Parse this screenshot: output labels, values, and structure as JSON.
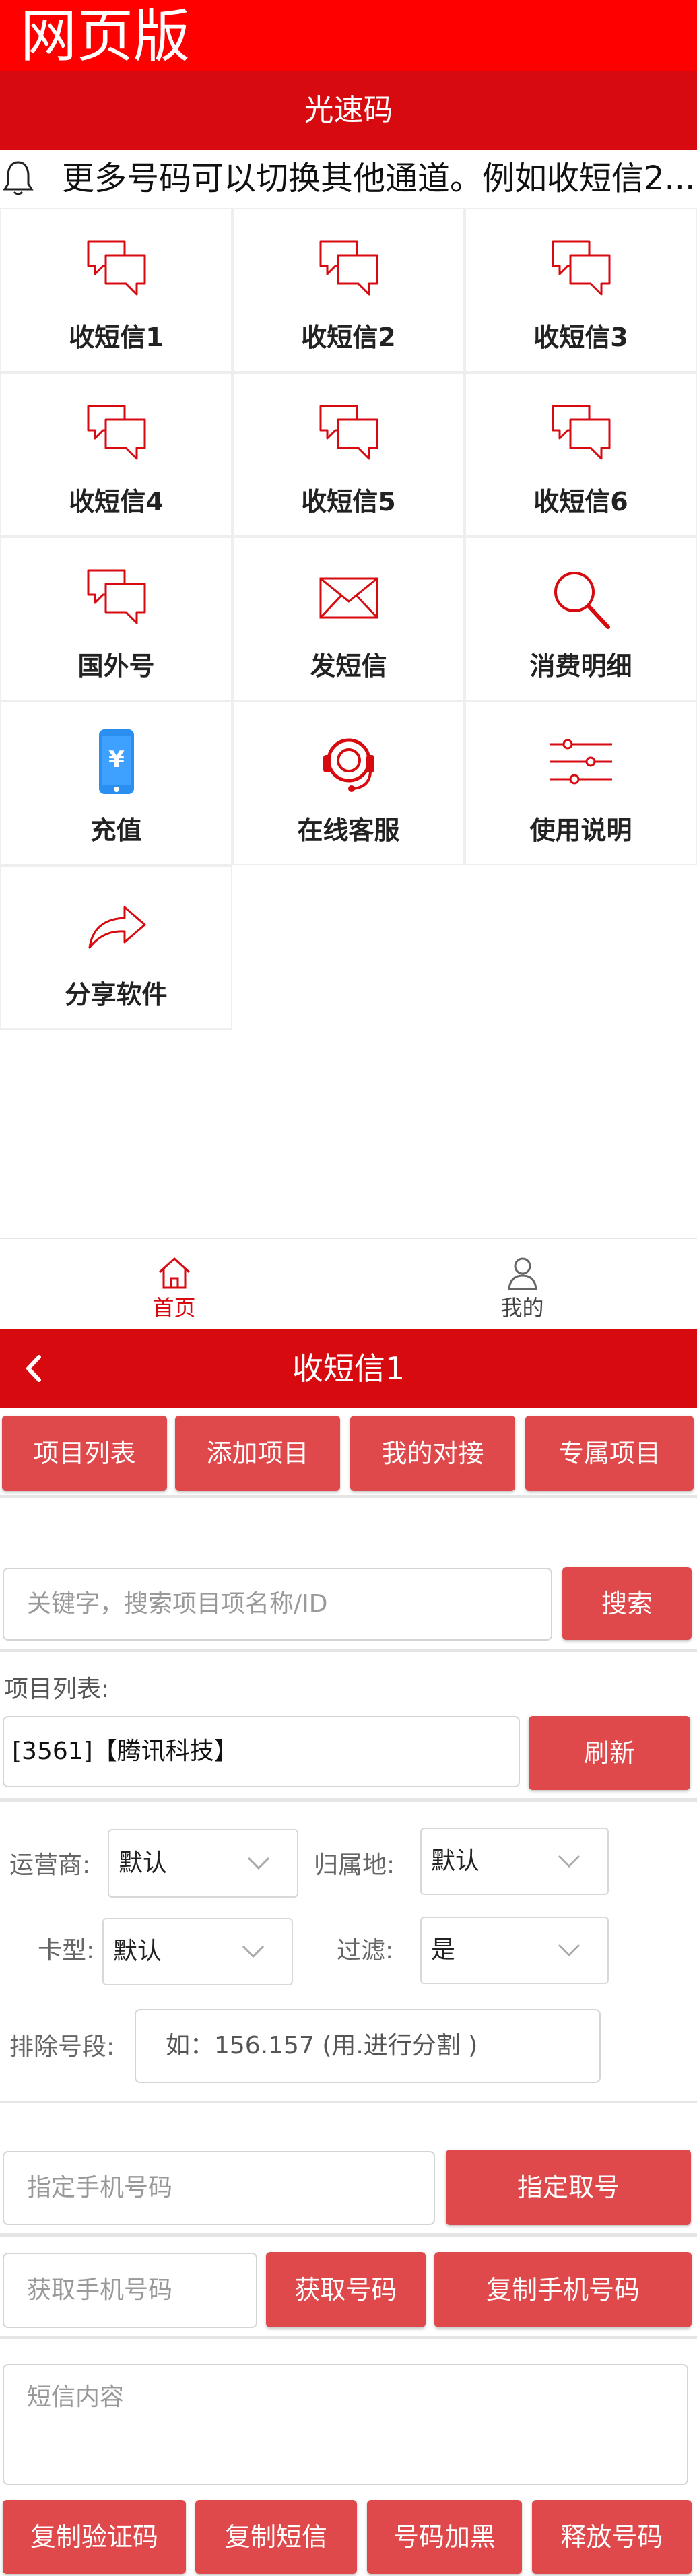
{
  "top_label": "网页版",
  "header": {
    "title": "光速码"
  },
  "notice": {
    "text": "更多号码可以切换其他通道。例如收短信2..."
  },
  "grid": [
    {
      "label": "收短信1",
      "icon": "chat-bubbles-icon"
    },
    {
      "label": "收短信2",
      "icon": "chat-bubbles-icon"
    },
    {
      "label": "收短信3",
      "icon": "chat-bubbles-icon"
    },
    {
      "label": "收短信4",
      "icon": "chat-bubbles-icon"
    },
    {
      "label": "收短信5",
      "icon": "chat-bubbles-icon"
    },
    {
      "label": "收短信6",
      "icon": "chat-bubbles-icon"
    },
    {
      "label": "国外号",
      "icon": "chat-bubbles-icon"
    },
    {
      "label": "发短信",
      "icon": "envelope-icon"
    },
    {
      "label": "消费明细",
      "icon": "search-icon"
    },
    {
      "label": "充值",
      "icon": "phone-yen-icon"
    },
    {
      "label": "在线客服",
      "icon": "headset-icon"
    },
    {
      "label": "使用说明",
      "icon": "sliders-icon"
    },
    {
      "label": "分享软件",
      "icon": "share-icon"
    }
  ],
  "bottom_nav": {
    "home": "首页",
    "mine": "我的"
  },
  "page2": {
    "title": "收短信1",
    "tabs": [
      "项目列表",
      "添加项目",
      "我的对接",
      "专属项目"
    ],
    "search": {
      "placeholder": "关键字，搜索项目项名称/ID",
      "button": "搜索"
    },
    "project_list_label": "项目列表:",
    "project_value": "[3561]【腾讯科技】",
    "refresh_button": "刷新",
    "filters": {
      "carrier_label": "运营商:",
      "carrier_value": "默认",
      "region_label": "归属地:",
      "region_value": "默认",
      "card_label": "卡型:",
      "card_value": "默认",
      "filter_label": "过滤:",
      "filter_value": "是",
      "exclude_label": "排除号段:",
      "exclude_placeholder": "如：156.157 (用.进行分割 )"
    },
    "assign_phone": {
      "placeholder": "指定手机号码",
      "button": "指定取号"
    },
    "get_phone": {
      "placeholder": "获取手机号码",
      "get_button": "获取号码",
      "copy_button": "复制手机号码"
    },
    "sms_content": {
      "placeholder": "短信内容"
    },
    "actions": [
      "复制验证码",
      "复制短信",
      "号码加黑",
      "释放号码"
    ]
  },
  "colors": {
    "brand_red": "#d70a10",
    "top_red": "#ff0000",
    "button_red": "#e0494c"
  }
}
